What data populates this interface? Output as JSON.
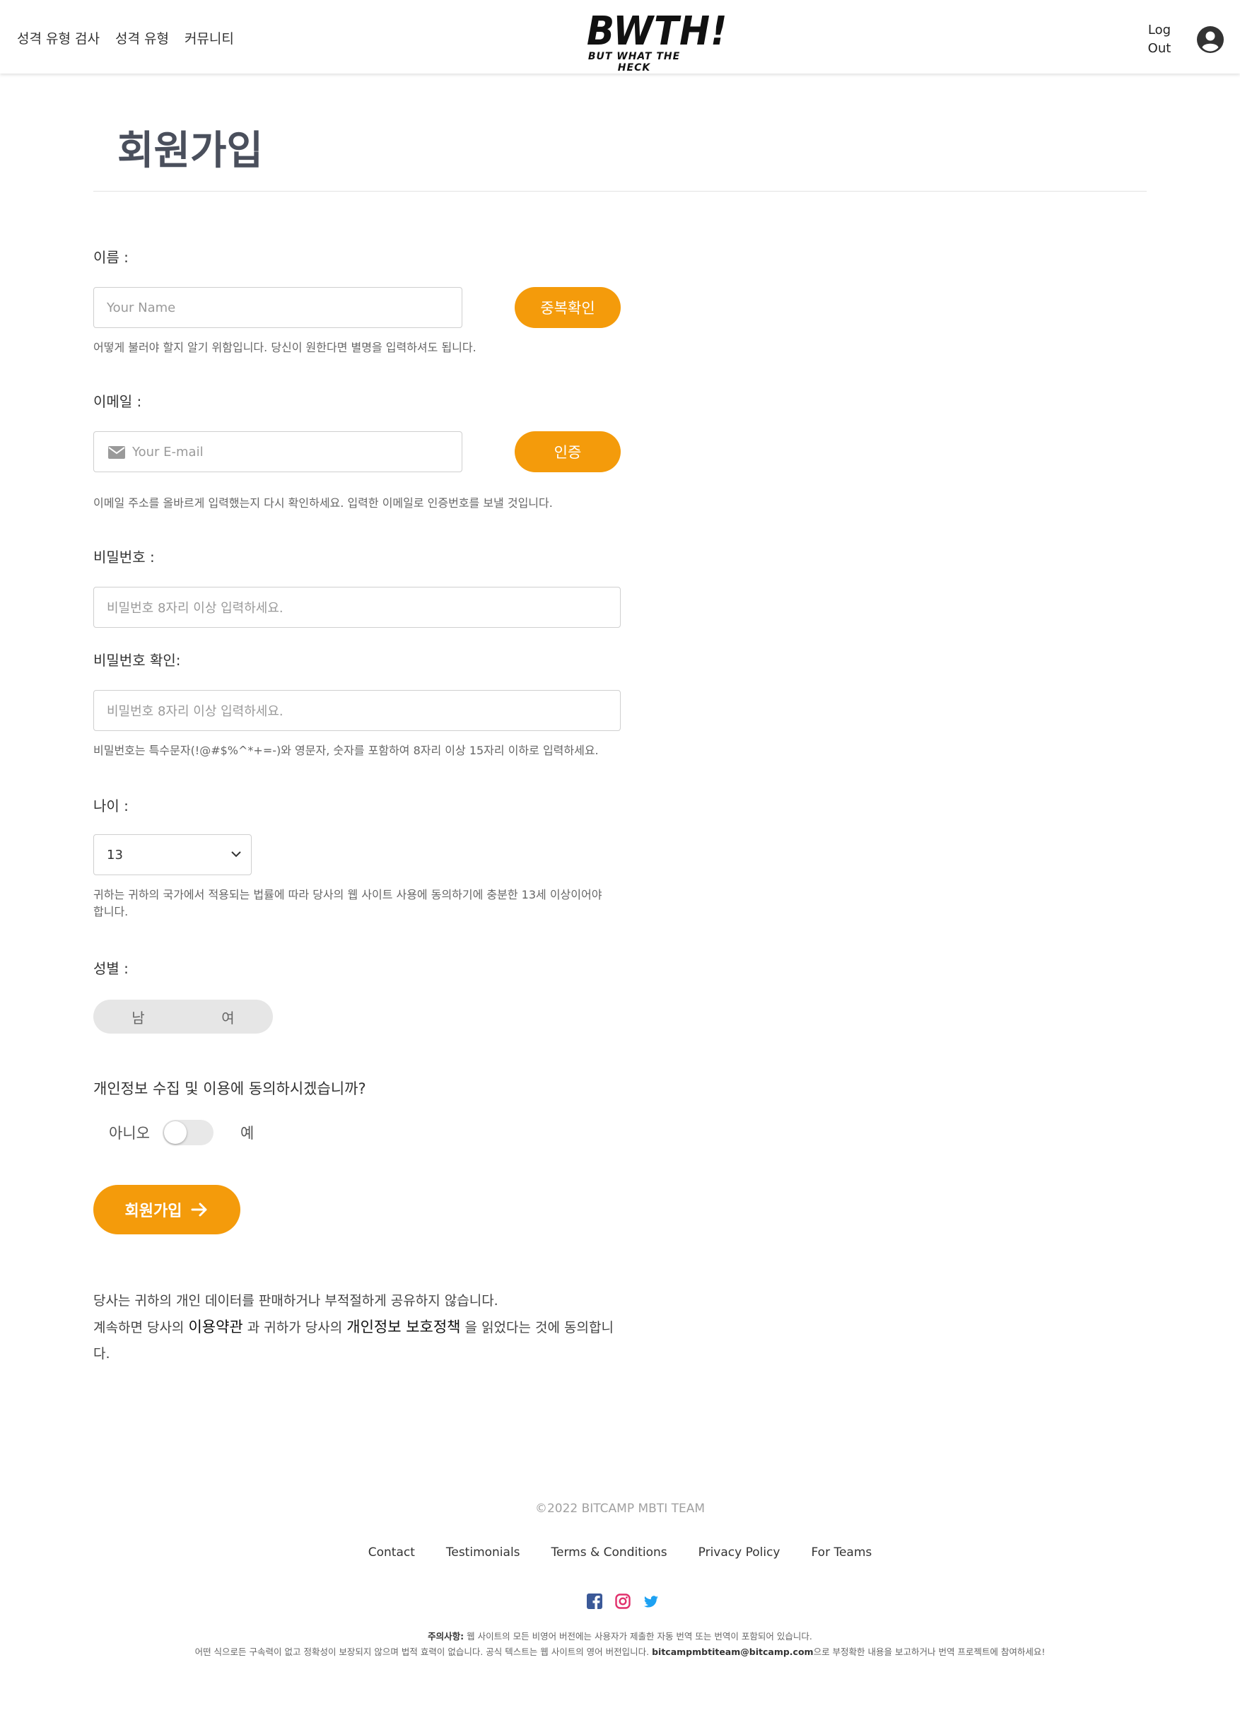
{
  "header": {
    "nav": [
      "성격 유형 검사",
      "성격 유형",
      "커뮤니티"
    ],
    "logo_main": "BWTH!",
    "logo_sub": "BUT WHAT THE HECK",
    "logout_line1": "Log",
    "logout_line2": "Out",
    "user_icon": "user-circle-icon"
  },
  "title": "회원가입",
  "form": {
    "name": {
      "label": "이름 :",
      "placeholder": "Your Name",
      "check_button": "중복확인",
      "help": "어떻게 불러야 할지 알기 위함입니다. 당신이 원한다면 별명을 입력하셔도 됩니다."
    },
    "email": {
      "label": "이메일 :",
      "placeholder": "Your E-mail",
      "icon": "envelope-icon",
      "verify_button": "인증",
      "help": "이메일 주소를 올바르게 입력했는지 다시 확인하세요. 입력한 이메일로 인증번호를 보낼 것입니다."
    },
    "password": {
      "label": "비밀번호 :",
      "placeholder": "비밀번호 8자리 이상 입력하세요."
    },
    "password_confirm": {
      "label": "비밀번호 확인:",
      "placeholder": "비밀번호 8자리 이상 입력하세요.",
      "help": "비밀번호는 특수문자(!@#$%^*+=-)와 영문자, 숫자를 포함하여 8자리 이상 15자리 이하로 입력하세요."
    },
    "age": {
      "label": "나이 :",
      "selected": "13",
      "help_line1": "귀하는 귀하의 국가에서 적용되는 법률에 따라 당사의 웹 사이트 사용에 동의하기에 충분한 13세 이상이어야",
      "help_line2": "합니다."
    },
    "gender": {
      "label": "성별 :",
      "male": "남",
      "female": "여"
    },
    "consent": {
      "question": "개인정보 수집 및 이용에 동의하시겠습니까?",
      "no": "아니오",
      "yes": "예",
      "checked": false
    },
    "submit": "회원가입"
  },
  "privacy": {
    "line1": "당사는 귀하의 개인 데이터를 판매하거나 부적절하게 공유하지 않습니다.",
    "line2_a": "계속하면 당사의 ",
    "terms_link": "이용약관",
    "line2_b": " 과 귀하가 당사의 ",
    "policy_link": "개인정보 보호정책",
    "line2_c": " 을 읽었다는 것에 동의합니다."
  },
  "footer": {
    "copyright": "©2022 BITCAMP MBTI TEAM",
    "links": [
      "Contact",
      "Testimonials",
      "Terms & Conditions",
      "Privacy Policy",
      "For Teams"
    ],
    "socials": [
      "facebook-icon",
      "instagram-icon",
      "twitter-icon"
    ],
    "disclaimer_bold": "주의사항:",
    "disclaimer_line1": " 웹 사이트의 모든 비영어 버전에는 사용자가 제출한 자동 번역 또는 번역이 포함되어 있습니다.",
    "disclaimer_line2a": "어떤 식으로든 구속력이 없고 정확성이 보장되지 않으며 법적 효력이 없습니다. 공식 텍스트는 웹 사이트의 영어 버전입니다. ",
    "disclaimer_email": "bitcampmbtiteam@bitcamp.com",
    "disclaimer_line2b": "으로 부정확한 내용을 보고하거나 번역 프로젝트에 참여하세요!"
  },
  "colors": {
    "accent": "#f49b0b",
    "title": "#4a4f5c",
    "facebook": "#3b5998",
    "instagram": "#e1306c",
    "twitter": "#1da1f2"
  }
}
